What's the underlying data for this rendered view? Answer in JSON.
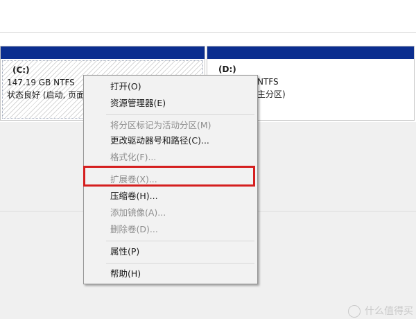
{
  "partitions": [
    {
      "label": "(C:)",
      "size_fs": "147.19 GB NTFS",
      "status": "状态良好 (启动, 页面"
    },
    {
      "label": "(D:)",
      "size_fs": "NTFS",
      "status": "主分区)"
    }
  ],
  "context_menu": {
    "items": [
      {
        "label": "打开(O)",
        "enabled": true
      },
      {
        "label": "资源管理器(E)",
        "enabled": true
      },
      {
        "label": "将分区标记为活动分区(M)",
        "enabled": false
      },
      {
        "label": "更改驱动器号和路径(C)...",
        "enabled": true
      },
      {
        "label": "格式化(F)...",
        "enabled": false
      },
      {
        "label": "扩展卷(X)...",
        "enabled": false
      },
      {
        "label": "压缩卷(H)...",
        "enabled": true
      },
      {
        "label": "添加镜像(A)...",
        "enabled": false
      },
      {
        "label": "删除卷(D)...",
        "enabled": false
      },
      {
        "label": "属性(P)",
        "enabled": true
      },
      {
        "label": "帮助(H)",
        "enabled": true
      }
    ]
  },
  "colors": {
    "partition_bar": "#0b2e8f",
    "highlight": "#d51f1f"
  },
  "watermark": {
    "text": "什么值得买"
  }
}
